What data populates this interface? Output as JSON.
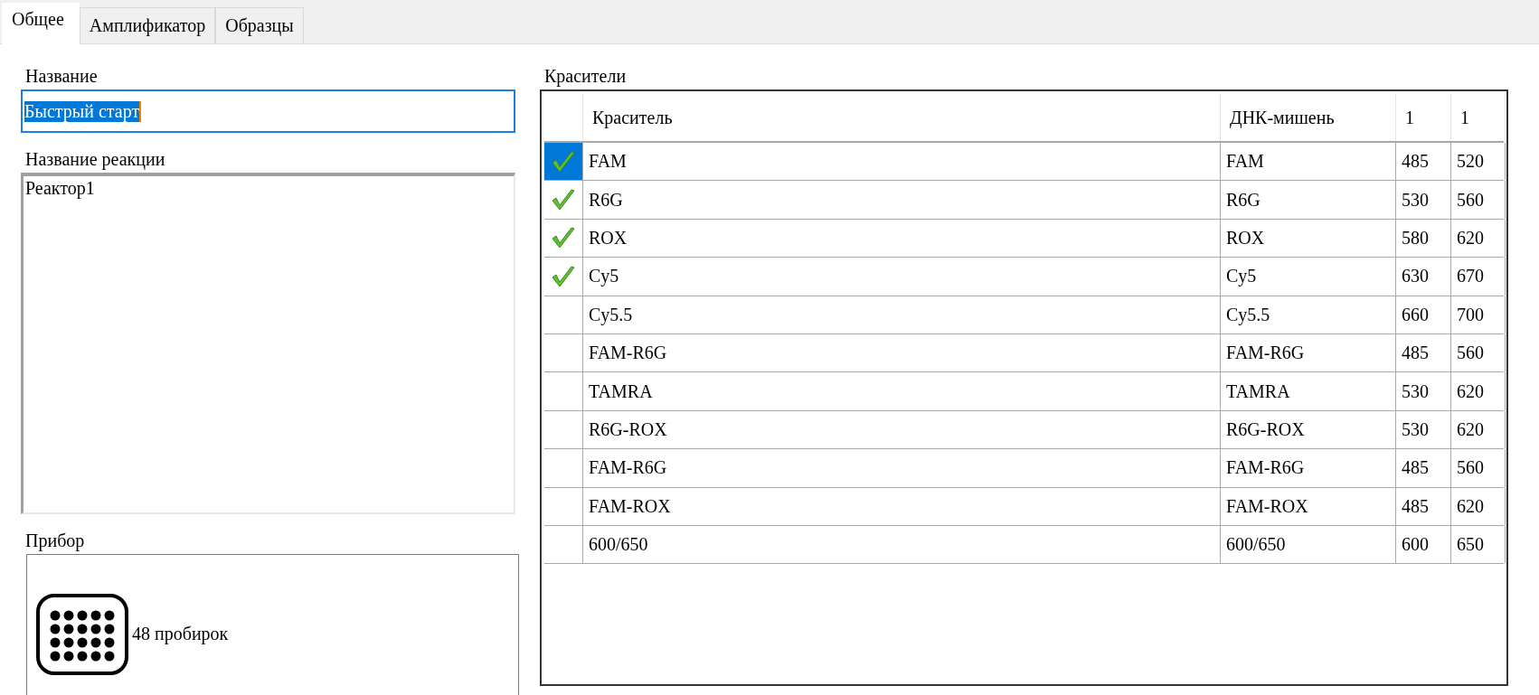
{
  "tabs": [
    {
      "label": "Общее",
      "selected": true
    },
    {
      "label": "Амплификатор",
      "selected": false
    },
    {
      "label": "Образцы",
      "selected": false
    }
  ],
  "name": {
    "label": "Название",
    "value": "Быстрый старт",
    "text_selected": true
  },
  "reaction": {
    "label": "Название реакции",
    "value": "Реактор1"
  },
  "device": {
    "label": "Прибор",
    "text": "48 пробирок"
  },
  "dyes": {
    "label": "Красители",
    "columns": [
      "Краситель",
      "ДНК-мишень",
      "1",
      "1"
    ],
    "rows": [
      {
        "dye": "FAM",
        "target": "FAM",
        "col_3": "485",
        "col_4": "520",
        "checked": true,
        "selected": true
      },
      {
        "dye": "R6G",
        "target": "R6G",
        "col_3": "530",
        "col_4": "560",
        "checked": true,
        "selected": false
      },
      {
        "dye": "ROX",
        "target": "ROX",
        "col_3": "580",
        "col_4": "620",
        "checked": true,
        "selected": false
      },
      {
        "dye": "Cy5",
        "target": "Cy5",
        "col_3": "630",
        "col_4": "670",
        "checked": true,
        "selected": false
      },
      {
        "dye": "Cy5.5",
        "target": "Cy5.5",
        "col_3": "660",
        "col_4": "700",
        "checked": false,
        "selected": false
      },
      {
        "dye": "FAM-R6G",
        "target": "FAM-R6G",
        "col_3": "485",
        "col_4": "560",
        "checked": false,
        "selected": false
      },
      {
        "dye": "TAMRA",
        "target": "TAMRA",
        "col_3": "530",
        "col_4": "620",
        "checked": false,
        "selected": false
      },
      {
        "dye": "R6G-ROX",
        "target": "R6G-ROX",
        "col_3": "530",
        "col_4": "620",
        "checked": false,
        "selected": false
      },
      {
        "dye": "FAM-R6G",
        "target": "FAM-R6G",
        "col_3": "485",
        "col_4": "560",
        "checked": false,
        "selected": false
      },
      {
        "dye": "FAM-ROX",
        "target": "FAM-ROX",
        "col_3": "485",
        "col_4": "620",
        "checked": false,
        "selected": false
      },
      {
        "dye": "600/650",
        "target": "600/650",
        "col_3": "600",
        "col_4": "650",
        "checked": false,
        "selected": false
      }
    ]
  }
}
